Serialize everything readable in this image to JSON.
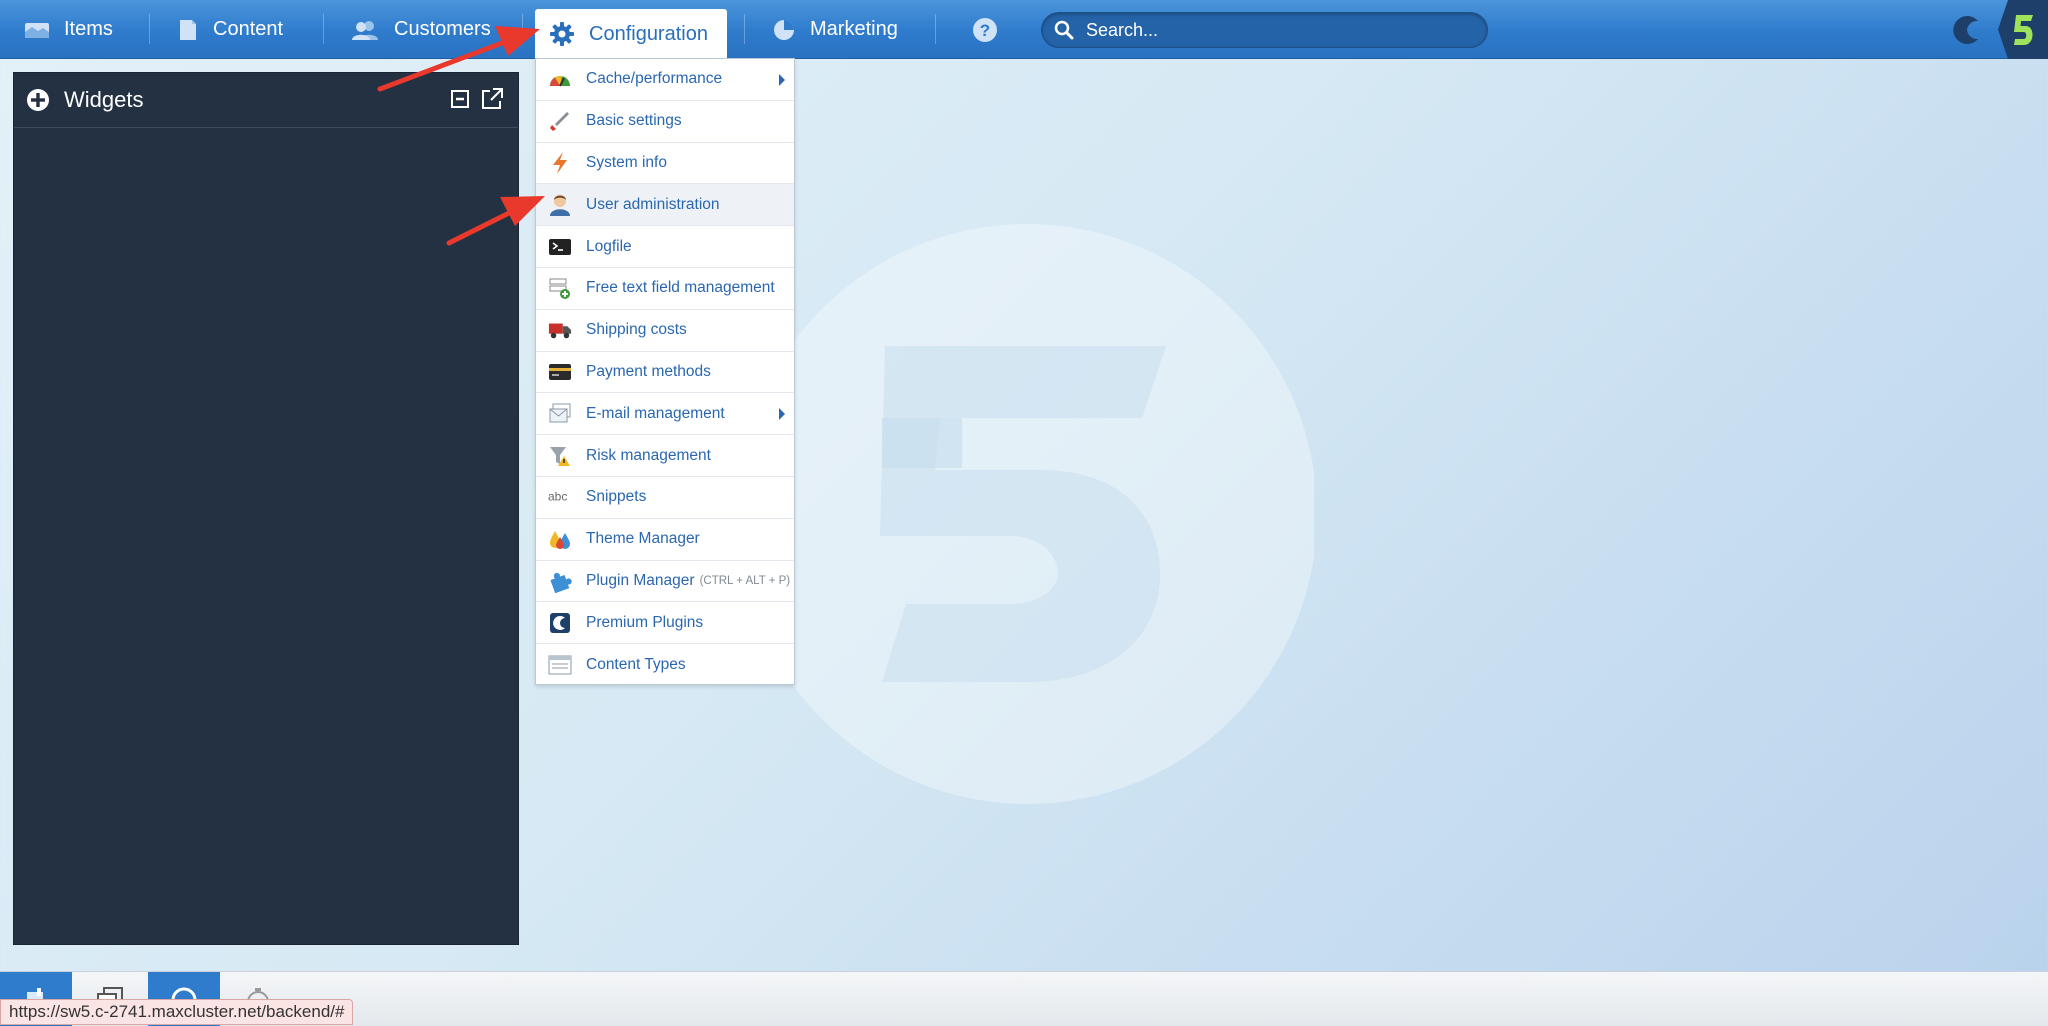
{
  "topbar": {
    "nav": [
      {
        "label": "Items",
        "icon": "items-icon"
      },
      {
        "label": "Content",
        "icon": "content-icon"
      },
      {
        "label": "Customers",
        "icon": "customers-icon"
      },
      {
        "label": "Configuration",
        "icon": "gear-icon",
        "active": true
      },
      {
        "label": "Marketing",
        "icon": "pie-chart-icon"
      }
    ],
    "search_placeholder": "Search..."
  },
  "widgets": {
    "title": "Widgets"
  },
  "config_menu": {
    "items": [
      {
        "label": "Cache/performance",
        "icon": "speedometer-icon",
        "has_submenu": true
      },
      {
        "label": "Basic settings",
        "icon": "wrench-icon"
      },
      {
        "label": "System info",
        "icon": "lightning-icon"
      },
      {
        "label": "User administration",
        "icon": "user-icon",
        "hovered": true
      },
      {
        "label": "Logfile",
        "icon": "terminal-icon"
      },
      {
        "label": "Free text field management",
        "icon": "form-add-icon"
      },
      {
        "label": "Shipping costs",
        "icon": "truck-icon"
      },
      {
        "label": "Payment methods",
        "icon": "credit-card-icon"
      },
      {
        "label": "E-mail management",
        "icon": "email-icon",
        "has_submenu": true
      },
      {
        "label": "Risk management",
        "icon": "funnel-warning-icon"
      },
      {
        "label": "Snippets",
        "icon": "abc-icon"
      },
      {
        "label": "Theme Manager",
        "icon": "color-drops-icon"
      },
      {
        "label": "Plugin Manager",
        "shortcut": "(CTRL + ALT + P)",
        "icon": "puzzle-icon"
      },
      {
        "label": "Premium Plugins",
        "icon": "shopware-icon"
      },
      {
        "label": "Content Types",
        "icon": "content-types-icon"
      }
    ]
  },
  "status_bar": {
    "url": "https://sw5.c-2741.maxcluster.net/backend/#"
  },
  "colors": {
    "topbar": "#2f7bcc",
    "widgets_bg": "#243143",
    "menu_text": "#2a67b0",
    "annotation": "#e8392c"
  }
}
